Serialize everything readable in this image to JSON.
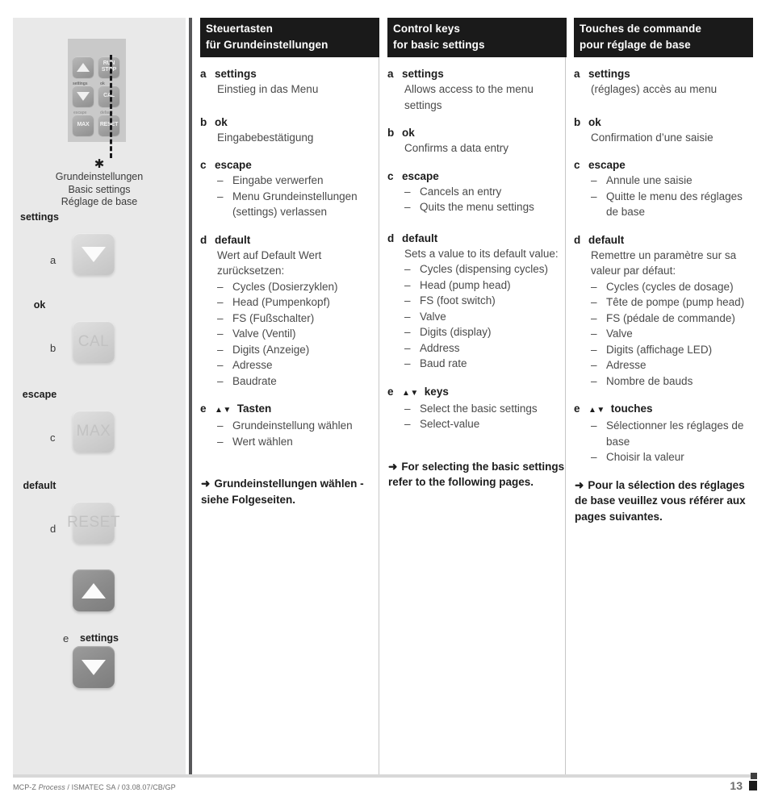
{
  "sidebar": {
    "keypad": {
      "keys": [
        {
          "name": "up-arrow",
          "glyph": "▲"
        },
        {
          "name": "run-stop",
          "line1": "RUN",
          "line2": "STOP"
        },
        {
          "name": "down-arrow",
          "glyph": "▼"
        },
        {
          "name": "cal",
          "label": "CAL"
        },
        {
          "name": "max",
          "label": "MAX"
        },
        {
          "name": "reset",
          "label": "RESET"
        }
      ],
      "mini_labels": {
        "settings": "settings",
        "ok": "ok",
        "escape": "escape",
        "default": "default"
      }
    },
    "star": "✱",
    "caption": [
      "Grundeinstellungen",
      "Basic settings",
      "Réglage de base"
    ],
    "big_keys": [
      {
        "letter": "a",
        "label": "settings",
        "key_text": "",
        "style": "light",
        "icon": "triangle-down"
      },
      {
        "letter": "b",
        "label": "ok",
        "key_text": "CAL",
        "style": "light",
        "icon": "text"
      },
      {
        "letter": "c",
        "label": "escape",
        "key_text": "MAX",
        "style": "light",
        "icon": "text"
      },
      {
        "letter": "d",
        "label": "default",
        "key_text": "RESET",
        "style": "light",
        "icon": "text"
      }
    ],
    "e_group": {
      "letter": "e",
      "label": "settings",
      "keys": [
        {
          "name": "up-arrow",
          "icon": "triangle-up"
        },
        {
          "name": "down-arrow",
          "icon": "triangle-down"
        }
      ]
    }
  },
  "columns": {
    "de": {
      "header_line1": "Steuertasten",
      "header_line2": "für Grundeinstellungen",
      "entries": [
        {
          "letter": "a",
          "title": "settings",
          "desc": "Einstieg in das Menu",
          "items": []
        },
        {
          "letter": "b",
          "title": "ok",
          "desc": "Eingabebestätigung",
          "items": []
        },
        {
          "letter": "c",
          "title": "escape",
          "desc": "",
          "items": [
            "Eingabe verwerfen",
            "Menu Grundeinstellungen (settings) verlassen"
          ]
        },
        {
          "letter": "d",
          "title": "default",
          "desc": "Wert auf Default Wert zurücksetzen:",
          "items": [
            "Cycles (Dosierzyklen)",
            "Head (Pumpenkopf)",
            "FS (Fußschalter)",
            "Valve (Ventil)",
            "Digits (Anzeige)",
            "Adresse",
            "Baudrate"
          ]
        },
        {
          "letter": "e",
          "arrows": "▲▼",
          "title": "Tasten",
          "desc": "",
          "items": [
            "Grundeinstellung wählen",
            "Wert wählen"
          ]
        }
      ],
      "note": "Grundeinstellungen wählen - siehe Folgeseiten."
    },
    "en": {
      "header_line1": "Control keys",
      "header_line2": "for basic settings",
      "entries": [
        {
          "letter": "a",
          "title": "settings",
          "desc": "Allows access to the menu settings",
          "items": []
        },
        {
          "letter": "b",
          "title": "ok",
          "desc": "Confirms a data entry",
          "items": []
        },
        {
          "letter": "c",
          "title": "escape",
          "desc": "",
          "items": [
            "Cancels an entry",
            "Quits the menu settings"
          ]
        },
        {
          "letter": "d",
          "title": "default",
          "desc": "Sets a value to its default value:",
          "items": [
            "Cycles (dispensing cycles)",
            "Head (pump head)",
            "FS (foot switch)",
            "Valve",
            "Digits (display)",
            "Address",
            "Baud rate"
          ]
        },
        {
          "letter": "e",
          "arrows": "▲▼",
          "title": "keys",
          "desc": "",
          "items": [
            "Select the basic settings",
            "Select-value"
          ]
        }
      ],
      "note": "For selecting the basic settings refer to the following pages."
    },
    "fr": {
      "header_line1": "Touches de commande",
      "header_line2": "pour réglage de base",
      "entries": [
        {
          "letter": "a",
          "title": "settings",
          "desc": "(réglages) accès au menu",
          "items": []
        },
        {
          "letter": "b",
          "title": "ok",
          "desc": "Confirmation d’une saisie",
          "items": []
        },
        {
          "letter": "c",
          "title": "escape",
          "desc": "",
          "items": [
            "Annule une saisie",
            "Quitte le menu des réglages de base"
          ]
        },
        {
          "letter": "d",
          "title": "default",
          "desc": "Remettre un paramètre sur sa valeur par défaut:",
          "items": [
            "Cycles (cycles de dosage)",
            "Tête de pompe (pump head)",
            "FS (pédale de commande)",
            "Valve",
            "Digits (affichage LED)",
            "Adresse",
            "Nombre de bauds"
          ]
        },
        {
          "letter": "e",
          "arrows": "▲▼",
          "title": "touches",
          "desc": "",
          "items": [
            "Sélectionner les réglages de base",
            "Choisir la valeur"
          ]
        }
      ],
      "note": "Pour la sélection des réglages de base veuillez vous référer aux pages suivantes."
    }
  },
  "note_arrow": "➜",
  "footer": {
    "doc_part1": "MCP-Z ",
    "doc_italic": "Process",
    "doc_part2": " / ISMATEC SA / 03.08.07/CB/GP",
    "page_number": "13"
  }
}
